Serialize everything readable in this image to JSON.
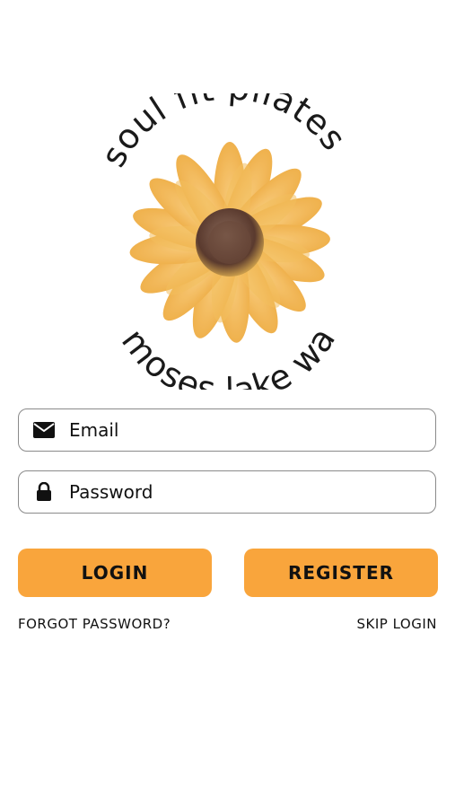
{
  "logo": {
    "top_text": "soul fit pilates",
    "bottom_text": "moses lake wa"
  },
  "form": {
    "email_placeholder": "Email",
    "password_placeholder": "Password"
  },
  "buttons": {
    "login_label": "LOGIN",
    "register_label": "REGISTER"
  },
  "links": {
    "forgot_label": "FORGOT PASSWORD?",
    "skip_label": "SKIP LOGIN"
  },
  "colors": {
    "accent": "#f9a53c",
    "petal": "#f2b54a",
    "center": "#6b4a3a"
  },
  "icons": {
    "email": "envelope-icon",
    "password": "lock-icon"
  }
}
